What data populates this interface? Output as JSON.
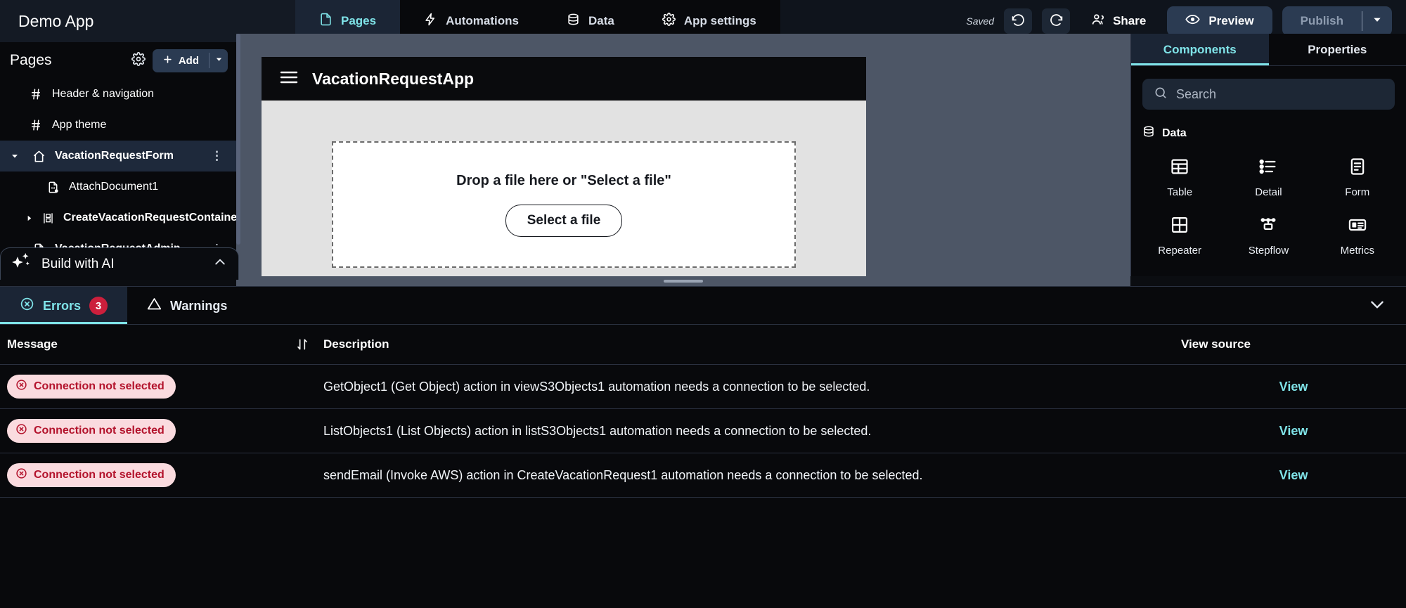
{
  "header": {
    "app_title": "Demo App",
    "tabs": [
      {
        "label": "Pages",
        "icon": "page-icon",
        "active": true
      },
      {
        "label": "Automations",
        "icon": "lightning-icon",
        "active": false
      },
      {
        "label": "Data",
        "icon": "database-icon",
        "active": false
      },
      {
        "label": "App settings",
        "icon": "gear-icon",
        "active": false
      }
    ],
    "save_status": "Saved",
    "undo_icon": "undo-icon",
    "redo_icon": "redo-icon",
    "share_label": "Share",
    "preview_label": "Preview",
    "publish_label": "Publish",
    "publish_caret_icon": "chevron-down-icon"
  },
  "sidebar": {
    "title": "Pages",
    "settings_icon": "gear-icon",
    "add_label": "Add",
    "add_caret_icon": "chevron-down-icon",
    "items": [
      {
        "label": "Header & navigation",
        "icon": "hash-icon",
        "indent": 1,
        "caret": "",
        "selected": false
      },
      {
        "label": "App theme",
        "icon": "hash-icon",
        "indent": 1,
        "caret": "",
        "selected": false
      },
      {
        "label": "VacationRequestForm",
        "icon": "home-icon",
        "indent": 0,
        "caret": "down",
        "selected": true,
        "menu": "⋮"
      },
      {
        "label": "AttachDocument1",
        "icon": "s3-file-icon",
        "indent": 2,
        "caret": "",
        "selected": false
      },
      {
        "label": "CreateVacationRequestContainer",
        "icon": "container-icon",
        "indent": 1,
        "caret": "right",
        "selected": false
      },
      {
        "label": "VacationRequestAdmin",
        "icon": "page-icon",
        "indent": 0,
        "caret": "down",
        "selected": false,
        "menu": "⋮"
      }
    ]
  },
  "build_ai": {
    "label": "Build with AI",
    "sparkle_icon": "sparkle-icon",
    "collapse_icon": "chevron-up-icon"
  },
  "canvas": {
    "device_title": "VacationRequestApp",
    "menu_icon": "hamburger-icon",
    "dropzone_text": "Drop a file here or \"Select a file\"",
    "select_file_label": "Select a file",
    "drag_handle": "panel-resize-handle"
  },
  "right_panel": {
    "tabs": [
      {
        "label": "Components",
        "active": true
      },
      {
        "label": "Properties",
        "active": false
      }
    ],
    "search_placeholder": "Search",
    "search_icon": "search-icon",
    "sections": [
      {
        "title": "Data",
        "icon": "database-icon",
        "components": [
          {
            "label": "Table",
            "icon": "table-icon"
          },
          {
            "label": "Detail",
            "icon": "detail-list-icon"
          },
          {
            "label": "Form",
            "icon": "form-icon"
          },
          {
            "label": "Repeater",
            "icon": "repeater-grid-icon"
          },
          {
            "label": "Stepflow",
            "icon": "stepflow-icon"
          },
          {
            "label": "Metrics",
            "icon": "metrics-card-icon"
          }
        ]
      }
    ]
  },
  "bottom_panel": {
    "tabs": [
      {
        "label": "Errors",
        "icon": "error-circle-icon",
        "badge": "3",
        "active": true
      },
      {
        "label": "Warnings",
        "icon": "warning-triangle-icon",
        "badge": "",
        "active": false
      }
    ],
    "collapse_icon": "chevron-down-icon",
    "columns": {
      "message": "Message",
      "sort_icon": "sort-icon",
      "description": "Description",
      "view_source": "View source"
    },
    "rows": [
      {
        "status": "Connection not selected",
        "description": "GetObject1 (Get Object) action in viewS3Objects1 automation needs a connection to be selected.",
        "view": "View"
      },
      {
        "status": "Connection not selected",
        "description": "ListObjects1 (List Objects) action in listS3Objects1 automation needs a connection to be selected.",
        "view": "View"
      },
      {
        "status": "Connection not selected",
        "description": "sendEmail (Invoke AWS) action in CreateVacationRequest1 automation needs a connection to be selected.",
        "view": "View"
      }
    ]
  },
  "colors": {
    "accent": "#7fe3e8",
    "error": "#cc1f3c",
    "error_pill_bg": "#fadbdf",
    "error_pill_text": "#b3132c",
    "panel_bg": "#08090c",
    "button_bg": "#2b3b52"
  }
}
